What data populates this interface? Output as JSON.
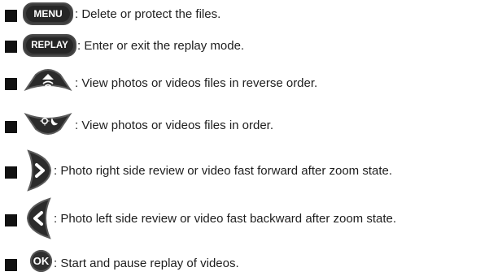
{
  "rows": [
    {
      "button": "MENU",
      "description": ": Delete or protect the files."
    },
    {
      "button": "REPLAY",
      "description": ": Enter or exit the replay mode."
    },
    {
      "button": "up-arrow",
      "description": ": View photos or videos files in reverse order."
    },
    {
      "button": "down-arrow",
      "description": ": View photos or videos files in order."
    },
    {
      "button": "right-arrow",
      "description": ": Photo right side review or video fast forward after zoom state."
    },
    {
      "button": "left-arrow",
      "description": ": Photo left side review or video fast backward after zoom state."
    },
    {
      "button": "OK",
      "description": ": Start and pause replay of videos."
    }
  ],
  "colors": {
    "button_fill": "#2b2b2b",
    "button_rim": "#555555",
    "bullet": "#111111",
    "text": "#1e1e1e"
  }
}
